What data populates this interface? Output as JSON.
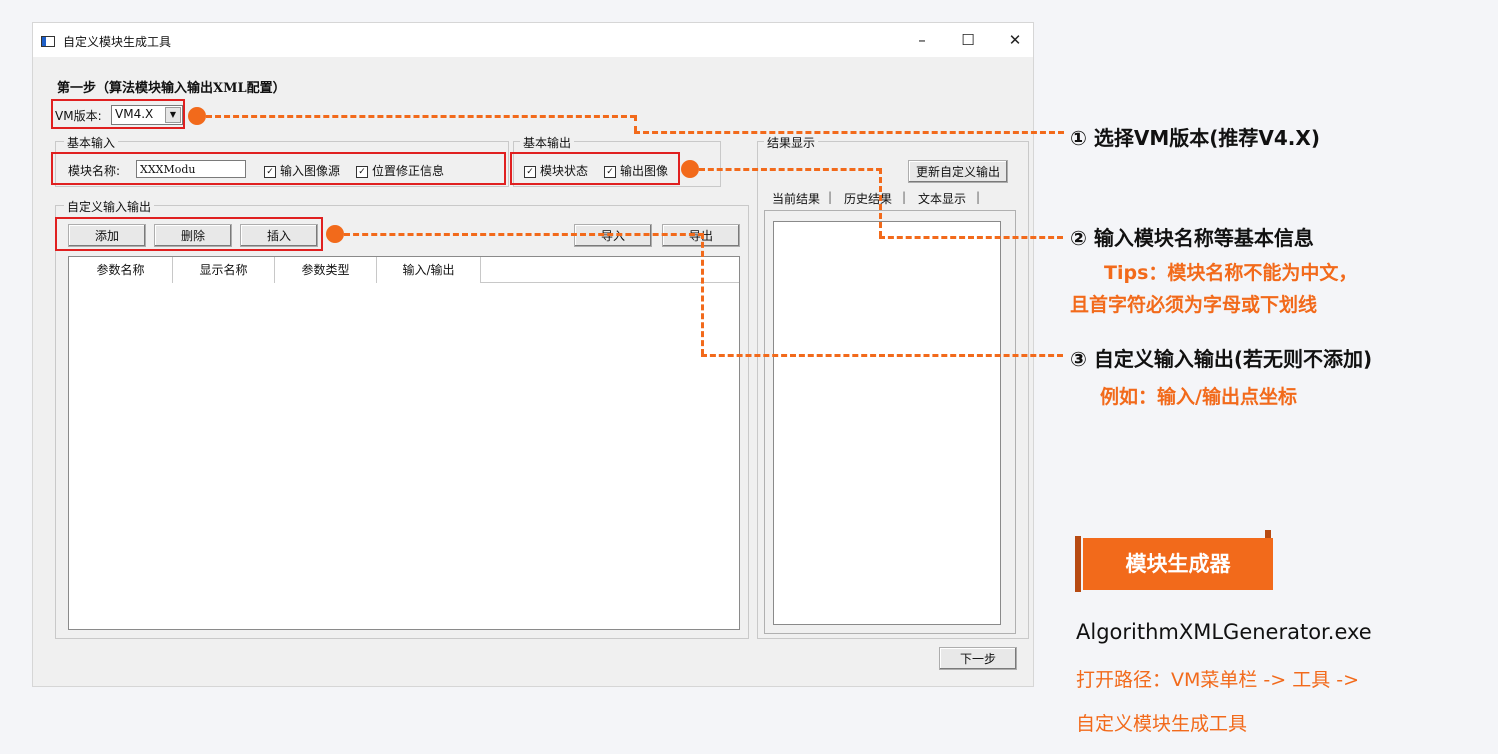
{
  "window": {
    "title": "自定义模块生成工具",
    "controls": {
      "minimize": "–",
      "maximize": "☐",
      "close": "✕"
    }
  },
  "step_title": "第一步（算法模块输入输出XML配置）",
  "vm_version": {
    "label": "VM版本:",
    "value": "VM4.X"
  },
  "basic_input": {
    "legend": "基本输入",
    "module_name_label": "模块名称:",
    "module_name_value": "XXXModu",
    "checkbox_input_image": "输入图像源",
    "checkbox_position_fix": "位置修正信息"
  },
  "basic_output": {
    "legend": "基本输出",
    "checkbox_module_status": "模块状态",
    "checkbox_output_image": "输出图像"
  },
  "custom_io": {
    "legend": "自定义输入输出",
    "buttons": {
      "add": "添加",
      "delete": "删除",
      "insert": "插入",
      "import": "导入",
      "export": "导出"
    },
    "columns": [
      "参数名称",
      "显示名称",
      "参数类型",
      "输入/输出"
    ]
  },
  "result_panel": {
    "legend": "结果显示",
    "update_button": "更新自定义输出",
    "tabs": [
      "当前结果",
      "历史结果",
      "文本显示"
    ]
  },
  "next_button": "下一步",
  "annotations": {
    "a1": "① 选择VM版本(推荐V4.X)",
    "a2": "② 输入模块名称等基本信息",
    "a2_tip1": "Tips：模块名称不能为中文，",
    "a2_tip2": "且首字符必须为字母或下划线",
    "a3": "③ 自定义输入输出(若无则不添加)",
    "a3_tip": "例如：输入/输出点坐标"
  },
  "generator": {
    "badge": "模块生成器",
    "exe": "AlgorithmXMLGenerator.exe",
    "path1": "打开路径：VM菜单栏 -> 工具 ->",
    "path2": "自定义模块生成工具"
  },
  "colors": {
    "accent": "#f26a1b",
    "highlight": "#e02020"
  }
}
